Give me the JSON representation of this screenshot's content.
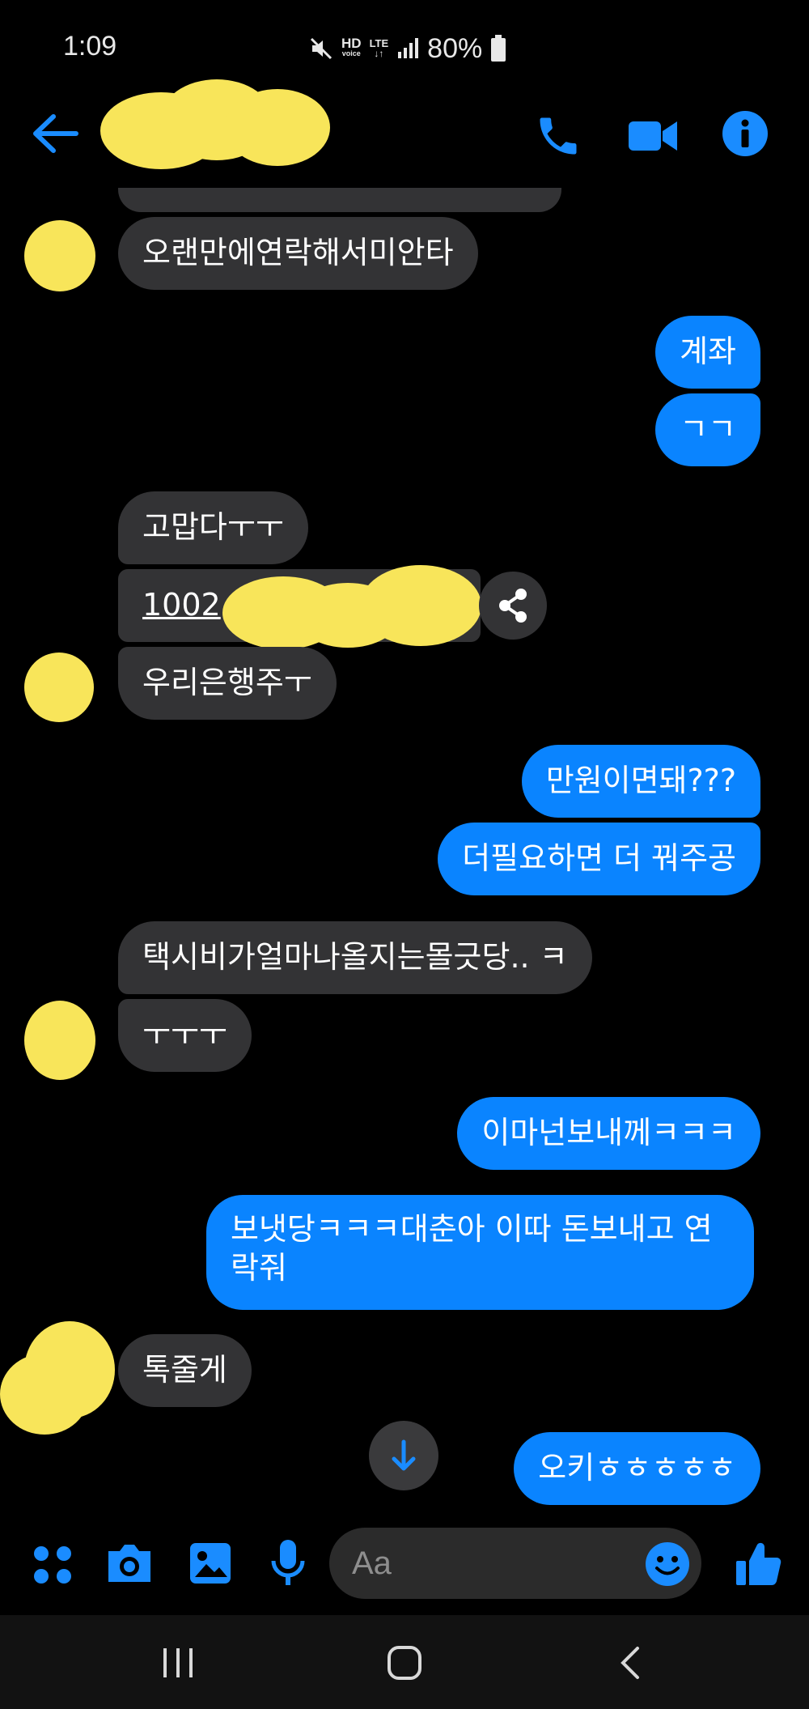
{
  "status_bar": {
    "time": "1:09",
    "hd": "HD",
    "voice": "voice",
    "lte": "LTE",
    "battery": "80%"
  },
  "composer": {
    "placeholder": "Aa"
  },
  "messages": {
    "m1": "오랜만에연락해서미안타",
    "m2": "계좌",
    "m3": "ㄱㄱ",
    "m4": "고맙다ㅜㅜ",
    "m5": "1002",
    "m6": "우리은행주ㅜ",
    "m7": "만원이면돼???",
    "m8": "더필요하면 더 꿔주공",
    "m9": "택시비가얼마나올지는몰긋당.. ㅋ",
    "m10": "ㅜㅜㅜ",
    "m11": "이마넌보내께ㅋㅋㅋ",
    "m12": "보냇당ㅋㅋㅋ대춘아 이따 돈보내고 연락줘",
    "m13": "톡줄게",
    "m14": "오키ㅎㅎㅎㅎㅎ"
  },
  "colors": {
    "accent": "#0a84ff",
    "incoming_bubble": "#333335",
    "redaction": "#f8e55a"
  },
  "icons": [
    "back-arrow-icon",
    "phone-icon",
    "video-call-icon",
    "info-icon",
    "share-icon",
    "scroll-down-icon",
    "apps-icon",
    "camera-icon",
    "gallery-icon",
    "microphone-icon",
    "emoji-icon",
    "thumbs-up-icon",
    "recents-icon",
    "home-icon",
    "back-icon"
  ]
}
